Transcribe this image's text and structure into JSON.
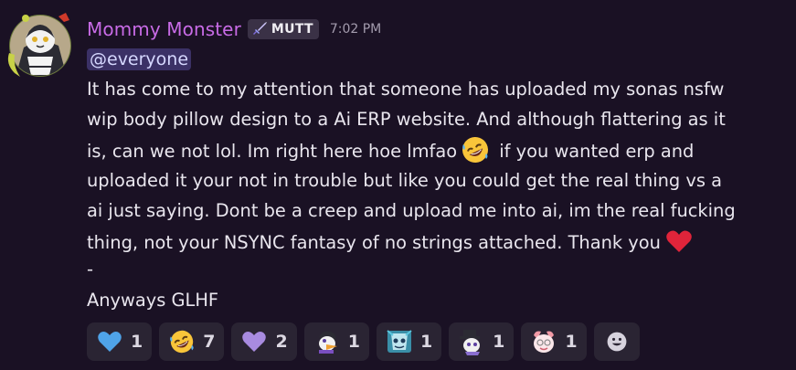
{
  "message": {
    "username": "Mommy Monster",
    "tag": {
      "label": "MUTT",
      "icon": "sword-icon"
    },
    "timestamp": "7:02 PM",
    "mention": "@everyone",
    "body_lines": [
      "It has come to my attention that someone has uploaded my sonas nsfw",
      "wip body pillow design to a Ai ERP website. And although flattering as it",
      "is, can we not lol. Im right here hoe lmfao",
      " if you wanted erp and",
      "uploaded it your not in trouble but like you could get the real thing vs a",
      "ai just saying. Dont be a creep and upload me into ai, im the real fucking",
      "thing, not your NSYNC fantasy of no strings attached. Thank you",
      "-",
      "Anyways GLHF"
    ]
  },
  "reactions": [
    {
      "emoji": "blue-heart-icon",
      "count": "1"
    },
    {
      "emoji": "rofl-icon",
      "count": "7"
    },
    {
      "emoji": "purple-heart-icon",
      "count": "2"
    },
    {
      "emoji": "custom-emoji-duck-sona-icon",
      "count": "1"
    },
    {
      "emoji": "custom-emoji-teal-sona-icon",
      "count": "1"
    },
    {
      "emoji": "custom-emoji-hat-sona-icon",
      "count": "1"
    },
    {
      "emoji": "custom-emoji-pink-sona-icon",
      "count": "1"
    }
  ],
  "colors": {
    "background": "#1a1124",
    "username": "#c86be6",
    "mention_bg": "#3b3166",
    "reaction_bg": "#2a2433"
  }
}
